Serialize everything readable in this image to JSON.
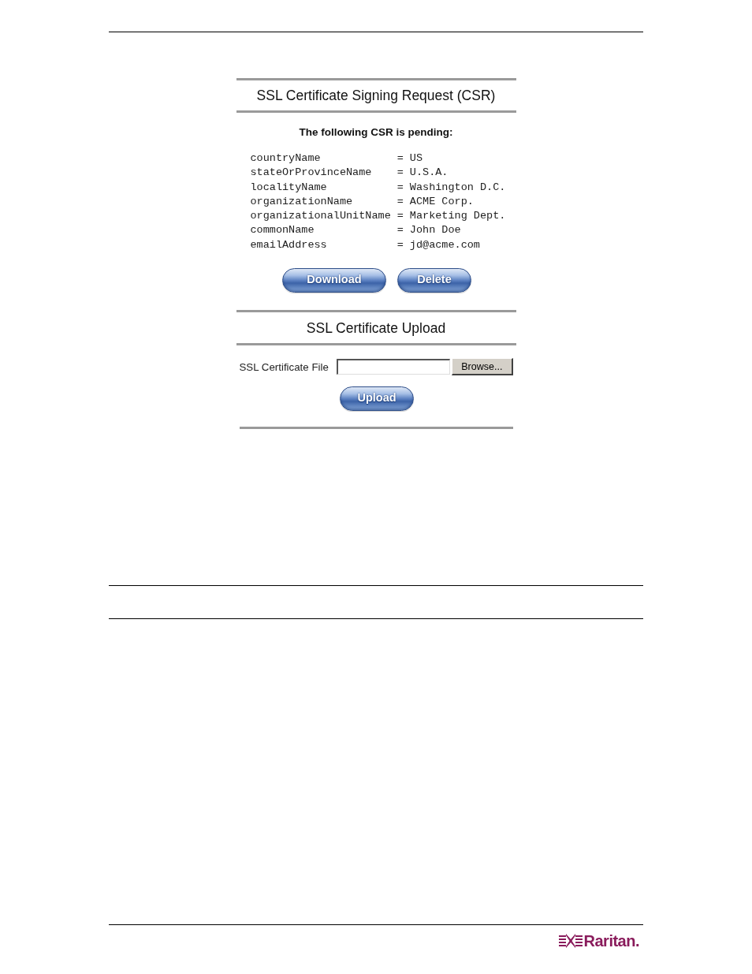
{
  "csr_section": {
    "title": "SSL Certificate Signing Request (CSR)",
    "status": "The following CSR is pending:",
    "fields": [
      {
        "name": "countryName",
        "separator": "=",
        "value": "US"
      },
      {
        "name": "stateOrProvinceName",
        "separator": "=",
        "value": "U.S.A."
      },
      {
        "name": "localityName",
        "separator": "=",
        "value": "Washington D.C."
      },
      {
        "name": "organizationName",
        "separator": "=",
        "value": "ACME Corp."
      },
      {
        "name": "organizationalUnitName",
        "separator": "=",
        "value": "Marketing Dept."
      },
      {
        "name": "commonName",
        "separator": "=",
        "value": "John Doe"
      },
      {
        "name": "emailAddress",
        "separator": "=",
        "value": "jd@acme.com"
      }
    ],
    "buttons": [
      "Download",
      "Delete"
    ]
  },
  "upload_section": {
    "title": "SSL Certificate Upload",
    "file_field": {
      "label": "SSL Certificate File",
      "browse_button": "Browse..."
    },
    "button": "Upload"
  },
  "footer": {
    "logo_text": "Raritan."
  }
}
